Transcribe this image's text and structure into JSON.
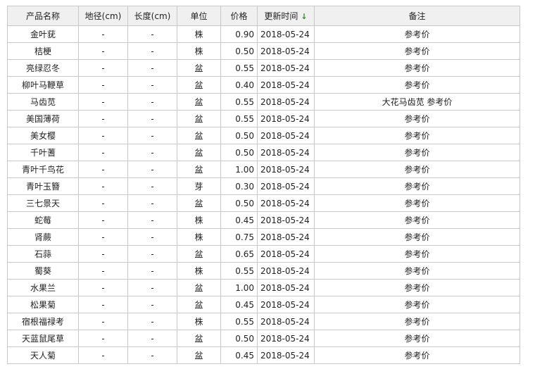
{
  "columns": {
    "name": "产品名称",
    "diameter": "地径(cm)",
    "length": "长度(cm)",
    "unit": "单位",
    "price": "价格",
    "updated": "更新时间",
    "note": "备注"
  },
  "sort_arrow": "↓",
  "sort_arrow_color": "#2e8b2e",
  "rows": [
    {
      "name": "金叶莸",
      "diameter": "-",
      "length": "-",
      "unit": "株",
      "price": "0.90",
      "updated": "2018-05-24",
      "note": "参考价"
    },
    {
      "name": "桔梗",
      "diameter": "-",
      "length": "-",
      "unit": "株",
      "price": "0.50",
      "updated": "2018-05-24",
      "note": "参考价"
    },
    {
      "name": "亮绿忍冬",
      "diameter": "-",
      "length": "-",
      "unit": "盆",
      "price": "0.55",
      "updated": "2018-05-24",
      "note": "参考价"
    },
    {
      "name": "柳叶马鞭草",
      "diameter": "-",
      "length": "-",
      "unit": "盆",
      "price": "0.40",
      "updated": "2018-05-24",
      "note": "参考价"
    },
    {
      "name": "马齿苋",
      "diameter": "-",
      "length": "-",
      "unit": "盆",
      "price": "0.55",
      "updated": "2018-05-24",
      "note": "大花马齿苋 参考价"
    },
    {
      "name": "美国薄荷",
      "diameter": "-",
      "length": "-",
      "unit": "盆",
      "price": "0.55",
      "updated": "2018-05-24",
      "note": "参考价"
    },
    {
      "name": "美女樱",
      "diameter": "-",
      "length": "-",
      "unit": "盆",
      "price": "0.50",
      "updated": "2018-05-24",
      "note": "参考价"
    },
    {
      "name": "千叶蓍",
      "diameter": "-",
      "length": "-",
      "unit": "盆",
      "price": "0.50",
      "updated": "2018-05-24",
      "note": "参考价"
    },
    {
      "name": "青叶千鸟花",
      "diameter": "-",
      "length": "-",
      "unit": "盆",
      "price": "1.00",
      "updated": "2018-05-24",
      "note": "参考价"
    },
    {
      "name": "青叶玉簪",
      "diameter": "-",
      "length": "-",
      "unit": "芽",
      "price": "0.30",
      "updated": "2018-05-24",
      "note": "参考价"
    },
    {
      "name": "三七景天",
      "diameter": "-",
      "length": "-",
      "unit": "盆",
      "price": "0.50",
      "updated": "2018-05-24",
      "note": "参考价"
    },
    {
      "name": "蛇莓",
      "diameter": "-",
      "length": "-",
      "unit": "株",
      "price": "0.45",
      "updated": "2018-05-24",
      "note": "参考价"
    },
    {
      "name": "肾蕨",
      "diameter": "-",
      "length": "-",
      "unit": "株",
      "price": "0.75",
      "updated": "2018-05-24",
      "note": "参考价"
    },
    {
      "name": "石蒜",
      "diameter": "-",
      "length": "-",
      "unit": "盆",
      "price": "0.65",
      "updated": "2018-05-24",
      "note": "参考价"
    },
    {
      "name": "蜀葵",
      "diameter": "-",
      "length": "-",
      "unit": "株",
      "price": "0.55",
      "updated": "2018-05-24",
      "note": "参考价"
    },
    {
      "name": "水果兰",
      "diameter": "-",
      "length": "-",
      "unit": "盆",
      "price": "1.00",
      "updated": "2018-05-24",
      "note": "参考价"
    },
    {
      "name": "松果菊",
      "diameter": "-",
      "length": "-",
      "unit": "盆",
      "price": "0.45",
      "updated": "2018-05-24",
      "note": "参考价"
    },
    {
      "name": "宿根福禄考",
      "diameter": "-",
      "length": "-",
      "unit": "株",
      "price": "0.55",
      "updated": "2018-05-24",
      "note": "参考价"
    },
    {
      "name": "天蓝鼠尾草",
      "diameter": "-",
      "length": "-",
      "unit": "盆",
      "price": "0.50",
      "updated": "2018-05-24",
      "note": "参考价"
    },
    {
      "name": "天人菊",
      "diameter": "-",
      "length": "-",
      "unit": "盆",
      "price": "0.45",
      "updated": "2018-05-24",
      "note": "参考价"
    }
  ]
}
